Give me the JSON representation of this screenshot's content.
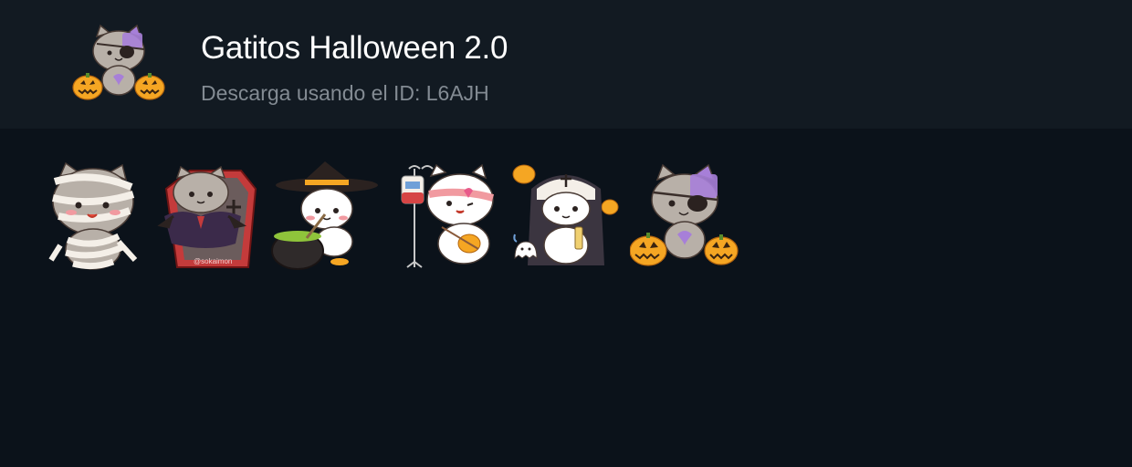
{
  "header": {
    "title": "Gatitos Halloween 2.0",
    "subtitle": "Descarga usando el ID: L6AJH",
    "icon": "pirate-zombie-cat-sticker"
  },
  "stickers": [
    {
      "name": "mummy-cat-sticker"
    },
    {
      "name": "vampire-coffin-cat-sticker",
      "coffin_text": "@sokaimon"
    },
    {
      "name": "witch-cauldron-cat-sticker"
    },
    {
      "name": "nurse-iv-cat-sticker"
    },
    {
      "name": "nun-cat-ghost-sticker"
    },
    {
      "name": "pirate-zombie-cat-pumpkins-sticker"
    }
  ],
  "colors": {
    "background": "#0b121a",
    "header_background": "#121a22",
    "title": "#ffffff",
    "subtitle": "#838b93",
    "pumpkin": "#f5a623",
    "patch_purple": "#a77fd8",
    "cat_gray": "#b8b0a8",
    "cat_white": "#ffffff"
  }
}
